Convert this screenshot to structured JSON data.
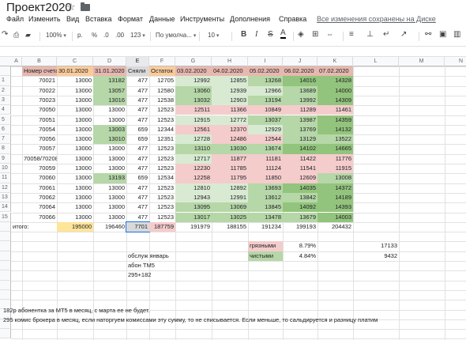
{
  "document": {
    "title": "Проект2020",
    "save_status": "Все изменения сохранены на Диске"
  },
  "menu": [
    "Файл",
    "Изменить",
    "Вид",
    "Вставка",
    "Формат",
    "Данные",
    "Инструменты",
    "Дополнения",
    "Справка"
  ],
  "toolbar": {
    "zoom": "100%",
    "currency": "р.",
    "percent": "%",
    "dec_less": ".0",
    "dec_more": ".00",
    "more_formats": "123",
    "font": "По умолча...",
    "font_size": "10",
    "bold": "B",
    "italic": "I",
    "strike": "S",
    "text_color": "A"
  },
  "colors": {
    "header_tan": "#e6b8af",
    "header_orange": "#f9cb9c",
    "green_strong": "#93c47d",
    "green_medium": "#b6d7a8",
    "green_light": "#d9ead3",
    "red_light": "#f4cccc",
    "yellow": "#ffe599",
    "gray": "#d9d9d9"
  },
  "columns": [
    "A",
    "B",
    "C",
    "D",
    "E",
    "F",
    "G",
    "H",
    "I",
    "J",
    "K",
    "L",
    "M",
    "N"
  ],
  "selected_column": "E",
  "header_row": [
    "Номер счета",
    "30.01.2020",
    "31.01.2020",
    "Сняли",
    "Остаток",
    "03.02.2020",
    "04.02.2020",
    "05.02.2020",
    "06.02.2020",
    "07.02.2020"
  ],
  "row_numbers": [
    "1",
    "2",
    "3",
    "4",
    "5",
    "6",
    "7",
    "8",
    "9",
    "10",
    "11",
    "12",
    "13",
    "14",
    "15"
  ],
  "rows": [
    [
      "70021",
      "13000",
      "13182",
      "477",
      "12705",
      "12992",
      "12855",
      "13268",
      "14016",
      "14328"
    ],
    [
      "70022",
      "13000",
      "13057",
      "477",
      "12580",
      "13060",
      "12939",
      "12966",
      "13689",
      "14000"
    ],
    [
      "70023",
      "13000",
      "13016",
      "477",
      "12538",
      "13032",
      "12903",
      "13194",
      "13992",
      "14309"
    ],
    [
      "70050",
      "13000",
      "13000",
      "477",
      "12523",
      "12511",
      "11366",
      "10849",
      "11289",
      "11461"
    ],
    [
      "70051",
      "13000",
      "13000",
      "477",
      "12523",
      "12915",
      "12772",
      "13037",
      "13987",
      "14359"
    ],
    [
      "70054",
      "13000",
      "13003",
      "659",
      "12344",
      "12561",
      "12370",
      "12929",
      "13769",
      "14132"
    ],
    [
      "70056",
      "13000",
      "13010",
      "659",
      "12351",
      "12728",
      "12486",
      "12544",
      "13129",
      "13522"
    ],
    [
      "70057",
      "13000",
      "13000",
      "477",
      "12523",
      "13110",
      "13030",
      "13674",
      "14102",
      "14665"
    ],
    [
      "70058/70208",
      "13000",
      "13000",
      "477",
      "12523",
      "12717",
      "11877",
      "11181",
      "11422",
      "11776"
    ],
    [
      "70059",
      "13000",
      "13000",
      "477",
      "12523",
      "12230",
      "11785",
      "11124",
      "11541",
      "11915"
    ],
    [
      "70060",
      "13000",
      "13193",
      "659",
      "12534",
      "12258",
      "11795",
      "11850",
      "12609",
      "13008"
    ],
    [
      "70061",
      "13000",
      "13000",
      "477",
      "12523",
      "12810",
      "12892",
      "13693",
      "14035",
      "14372"
    ],
    [
      "70062",
      "13000",
      "13000",
      "477",
      "12523",
      "12943",
      "12991",
      "13612",
      "13842",
      "14189"
    ],
    [
      "70064",
      "13000",
      "13000",
      "477",
      "12523",
      "13095",
      "13069",
      "13845",
      "14092",
      "14393"
    ],
    [
      "70066",
      "13000",
      "13000",
      "477",
      "12523",
      "13017",
      "13025",
      "13478",
      "13679",
      "14003"
    ]
  ],
  "totals": {
    "label": "итого:",
    "values": [
      "195000",
      "196460",
      "7701",
      "187759",
      "191979",
      "188155",
      "191234",
      "199193",
      "204432"
    ]
  },
  "side_table": [
    {
      "label": "грязными",
      "percent": "8.79%",
      "amount": "17133"
    },
    {
      "label": "чистыми",
      "percent": "4.84%",
      "amount": "9432"
    }
  ],
  "notes_column": [
    "обслуж январь",
    "абон ТМ5",
    "295+182"
  ],
  "footer_notes": [
    "182р абонентка за МТ5 в месяц, с марта ее не будет.",
    "295 комис брокера в месяц, если наторгуем комиссами эту сумму, то не списывается. Если меньше, то сальдируется и разницу платим"
  ]
}
